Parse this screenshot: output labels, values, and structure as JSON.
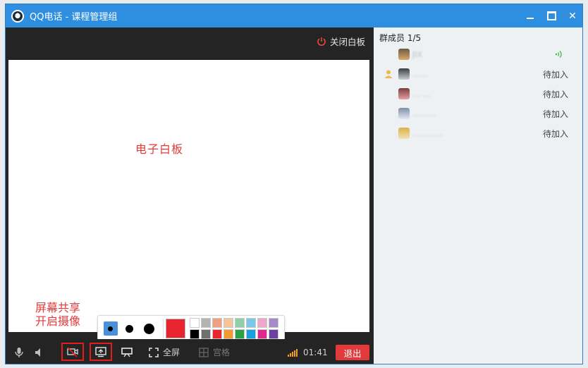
{
  "window": {
    "title": "QQ电话 - 课程管理组",
    "min": "",
    "max": "",
    "close": "✕"
  },
  "whiteboard": {
    "close_label": "关闭白板",
    "board_label": "电子白板",
    "palette": {
      "current_color": "#e8252e",
      "swatches": [
        "#ffffff",
        "#b3b3b3",
        "#f0a080",
        "#f4c49a",
        "#8fd0a8",
        "#7cc6e8",
        "#f0a6c8",
        "#a58ac8",
        "#000000",
        "#6f6f6f",
        "#e8252e",
        "#f39a2e",
        "#2aa148",
        "#1a9ee0",
        "#e0268c",
        "#6b3fa0"
      ]
    },
    "tools": [
      "text-tool",
      "pen-tool",
      "arrow-tool",
      "rectangle-tool",
      "ellipse-tool",
      "eraser-tool",
      "save-tool"
    ]
  },
  "annotations": {
    "line1": "屏幕共享",
    "line2": "开启摄像"
  },
  "bottombar": {
    "fullscreen": "全屏",
    "grid": "宫格",
    "timer": "01:41",
    "exit": "退出"
  },
  "members": {
    "title": "群成员 1/5",
    "list": [
      {
        "name": "JIX",
        "status": ""
      },
      {
        "name": "……",
        "status": "待加入"
      },
      {
        "name": "… …",
        "status": "待加入"
      },
      {
        "name": "………",
        "status": "待加入"
      },
      {
        "name": "…………",
        "status": "待加入"
      }
    ]
  }
}
